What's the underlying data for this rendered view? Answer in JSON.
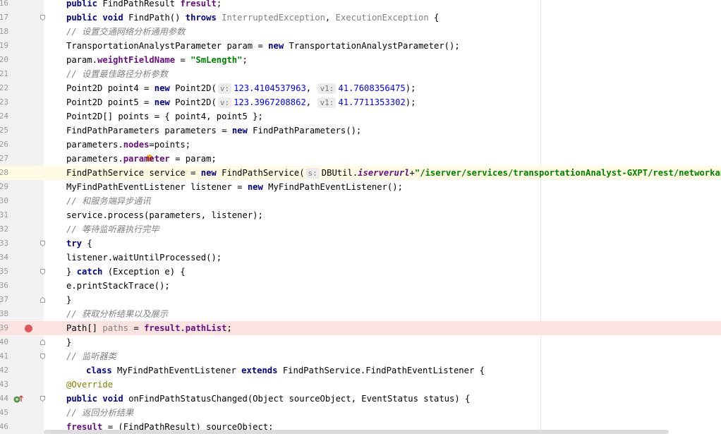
{
  "editor": {
    "line_numbers": [
      "16",
      "17",
      "18",
      "19",
      "20",
      "21",
      "22",
      "23",
      "24",
      "25",
      "26",
      "27",
      "28",
      "29",
      "30",
      "31",
      "32",
      "33",
      "34",
      "35",
      "36",
      "37",
      "38",
      "39",
      "40",
      "41",
      "42",
      "43",
      "44",
      "45",
      "46"
    ],
    "lines": {
      "l16": {
        "kw": "public",
        "type": "FindPathResult",
        "field": "fresult",
        ";": ";"
      },
      "l17": {
        "kw1": "public",
        "kw2": "void",
        "name": "FindPath()",
        "kw3": "throws",
        "exc1": "InterruptedException",
        "comma": ",",
        "exc2": "ExecutionException",
        "brace": "{"
      },
      "l18": {
        "comment": "// 设置交通网络分析通用参数"
      },
      "l19": {
        "text1": "TransportationAnalystParameter param = ",
        "kw": "new",
        "text2": "TransportationAnalystParameter();"
      },
      "l20": {
        "text1": "param.",
        "field": "weightFieldName",
        "text2": " = ",
        "str": "\"SmLength\"",
        "end": ";"
      },
      "l21": {
        "comment": "// 设置最佳路径分析参数"
      },
      "l22": {
        "text1": "Point2D point4 = ",
        "kw": "new",
        "text2": "Point2D(",
        "hint1": "v:",
        "num1": "123.4104537963",
        "comma": ",",
        "hint2": "v1:",
        "num2": "41.7608356475",
        "end": ");"
      },
      "l23": {
        "text1": "Point2D point5 = ",
        "kw": "new",
        "text2": "Point2D(",
        "hint1": "v:",
        "num1": "123.3967208862",
        "comma": ",",
        "hint2": "v1:",
        "num2": "41.7711353302",
        "end": ");"
      },
      "l24": {
        "text": "Point2D[] points = { point4, point5 };"
      },
      "l25": {
        "text1": "FindPathParameters parameters = ",
        "kw": "new",
        "text2": "FindPathParameters();"
      },
      "l26": {
        "text1": "parameters.",
        "field": "nodes",
        "text2": "=points;"
      },
      "l27": {
        "text1": "parameters.",
        "field": "parameter",
        "text2": " = param;"
      },
      "l28": {
        "text1": "FindPathService service = ",
        "kw": "new",
        "text2": "FindPathService(",
        "hint": "s:",
        "text3": "DBUtil.",
        "static": "iserverurl",
        "plus": "+",
        "str": "\"/iserver/services/transportationAnalyst-GXPT/rest/networkanalyst/"
      },
      "l29": {
        "text1": "MyFindPathEventListener listener = ",
        "kw": "new",
        "text2": "MyFindPathEventListener();"
      },
      "l30": {
        "comment": "// 和服务端异步通讯"
      },
      "l31": {
        "text": "service.process(parameters, listener);"
      },
      "l32": {
        "comment": "// 等待监听器执行完毕"
      },
      "l33": {
        "kw": "try",
        "text": " {"
      },
      "l34": {
        "text": "listener.waitUntilProcessed();"
      },
      "l35": {
        "text1": "} ",
        "kw": "catch",
        "text2": " (Exception e) {"
      },
      "l36": {
        "text": "e.printStackTrace();"
      },
      "l37": {
        "text": "}"
      },
      "l38": {
        "comment": "// 获取分析结果以及展示"
      },
      "l39": {
        "text1": "Path[] ",
        "unused": "paths",
        "text2": " = ",
        "field1": "fresult",
        "dot": ".",
        "field2": "pathList",
        "end": ";"
      },
      "l40": {
        "text": "}"
      },
      "l41": {
        "comment": "// 监听器类"
      },
      "l42": {
        "kw1": "class",
        "text1": " MyFindPathEventListener ",
        "kw2": "extends",
        "text2": " FindPathService.FindPathEventListener {"
      },
      "l43": {
        "ann": "@Override"
      },
      "l44": {
        "kw1": "public",
        "kw2": "void",
        "text": " onFindPathStatusChanged(Object sourceObject, EventStatus status) {"
      },
      "l45": {
        "comment": "// 返回分析结果"
      },
      "l46": {
        "field": "fresult",
        "text": " = (FindPathResult) sourceObject;"
      }
    },
    "icons": {
      "breakpoint": "breakpoint-icon",
      "override": "override-gutter-icon",
      "fold": "fold-icon",
      "intention": "intention-bulb-icon"
    },
    "colors": {
      "keyword": "#000080",
      "field": "#660e7a",
      "string": "#008000",
      "number": "#0000ff",
      "comment": "#808080",
      "caret_line": "#fffae3",
      "breakpoint_line": "#fae3e0",
      "breakpoint": "#db5860"
    }
  }
}
